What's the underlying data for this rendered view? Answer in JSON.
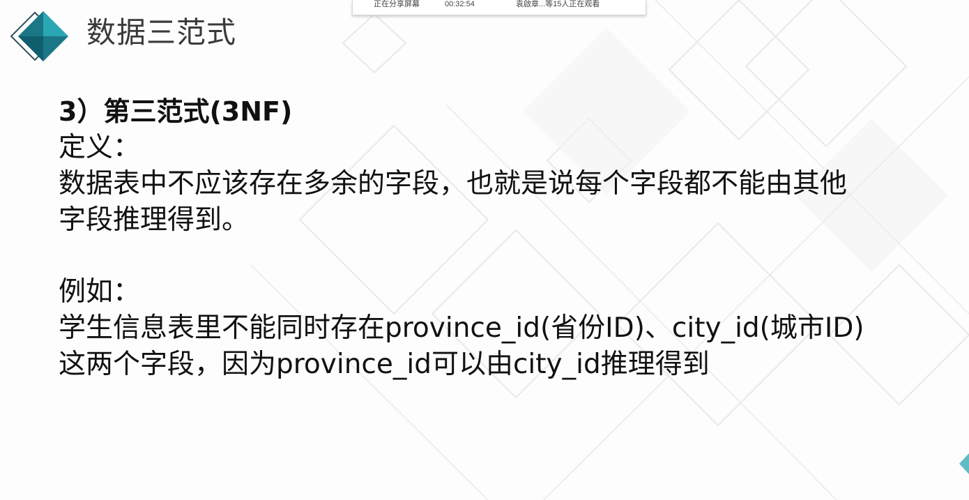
{
  "share_bar": {
    "status": "正在分享屏幕",
    "timer": "00:32:54",
    "viewers": "袁啟章...等15人正在观看"
  },
  "slide": {
    "title": "数据三范式",
    "heading": "3）第三范式(3NF)",
    "definition_label": "定义：",
    "definition_line1": "数据表中不应该存在多余的字段，也就是说每个字段都不能由其他",
    "definition_line2": "字段推理得到。",
    "example_label": "例如：",
    "example_line1": "学生信息表里不能同时存在province_id(省份ID)、city_id(城市ID)",
    "example_line2": "这两个字段，因为province_id可以由city_id推理得到"
  },
  "colors": {
    "logo_dark": "#0f5e6e",
    "logo_light": "#2ba7b4",
    "background_lines": "#e6e6e6"
  },
  "icons": {
    "logo": "diamond-logo-icon"
  }
}
